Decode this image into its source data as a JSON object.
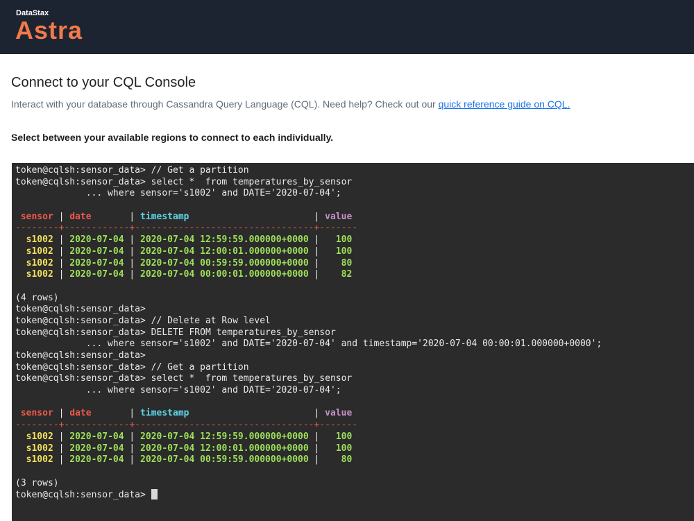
{
  "header": {
    "brand_small": "DataStax",
    "brand_big": "Astra",
    "bg_color": "#1c2431",
    "accent_color": "#f27a4a"
  },
  "page": {
    "title": "Connect to your CQL Console",
    "description_prefix": "Interact with your database through Cassandra Query Language (CQL). Need help? Check out our ",
    "description_link": "quick reference guide on CQL.",
    "region_note": "Select between your available regions to connect to each individually."
  },
  "console": {
    "prompt": "token@cqlsh:sensor_data> ",
    "lines": [
      {
        "kind": "cmd",
        "text": "// Get a partition"
      },
      {
        "kind": "cmd",
        "text": "select *  from temperatures_by_sensor"
      },
      {
        "kind": "cont",
        "text": "             ... where sensor='s1002' and DATE='2020-07-04';"
      },
      {
        "kind": "blank"
      },
      {
        "kind": "header"
      },
      {
        "kind": "rule"
      },
      {
        "kind": "row",
        "row": 0,
        "table": 0
      },
      {
        "kind": "row",
        "row": 1,
        "table": 0
      },
      {
        "kind": "row",
        "row": 2,
        "table": 0
      },
      {
        "kind": "row",
        "row": 3,
        "table": 0
      },
      {
        "kind": "blank"
      },
      {
        "kind": "plain",
        "text": "(4 rows)"
      },
      {
        "kind": "cmd",
        "text": ""
      },
      {
        "kind": "cmd",
        "text": "// Delete at Row level"
      },
      {
        "kind": "cmd",
        "text": "DELETE FROM temperatures_by_sensor"
      },
      {
        "kind": "cont",
        "text": "             ... where sensor='s1002' and DATE='2020-07-04' and timestamp='2020-07-04 00:00:01.000000+0000';"
      },
      {
        "kind": "cmd",
        "text": ""
      },
      {
        "kind": "cmd",
        "text": "// Get a partition"
      },
      {
        "kind": "cmd",
        "text": "select *  from temperatures_by_sensor"
      },
      {
        "kind": "cont",
        "text": "             ... where sensor='s1002' and DATE='2020-07-04';"
      },
      {
        "kind": "blank"
      },
      {
        "kind": "header"
      },
      {
        "kind": "rule"
      },
      {
        "kind": "row",
        "row": 0,
        "table": 1
      },
      {
        "kind": "row",
        "row": 1,
        "table": 1
      },
      {
        "kind": "row",
        "row": 2,
        "table": 1
      },
      {
        "kind": "blank"
      },
      {
        "kind": "plain",
        "text": "(3 rows)"
      },
      {
        "kind": "cursor"
      }
    ],
    "columns": [
      "sensor",
      "date",
      "timestamp",
      "value"
    ],
    "rule_text": "--------+------------+---------------------------------+-------",
    "tables": [
      [
        [
          "s1002",
          "2020-07-04",
          "2020-07-04 12:59:59.000000+0000",
          "100"
        ],
        [
          "s1002",
          "2020-07-04",
          "2020-07-04 12:00:01.000000+0000",
          "100"
        ],
        [
          "s1002",
          "2020-07-04",
          "2020-07-04 00:59:59.000000+0000",
          "80"
        ],
        [
          "s1002",
          "2020-07-04",
          "2020-07-04 00:00:01.000000+0000",
          "82"
        ]
      ],
      [
        [
          "s1002",
          "2020-07-04",
          "2020-07-04 12:59:59.000000+0000",
          "100"
        ],
        [
          "s1002",
          "2020-07-04",
          "2020-07-04 12:00:01.000000+0000",
          "100"
        ],
        [
          "s1002",
          "2020-07-04",
          "2020-07-04 00:59:59.000000+0000",
          "80"
        ]
      ]
    ]
  }
}
